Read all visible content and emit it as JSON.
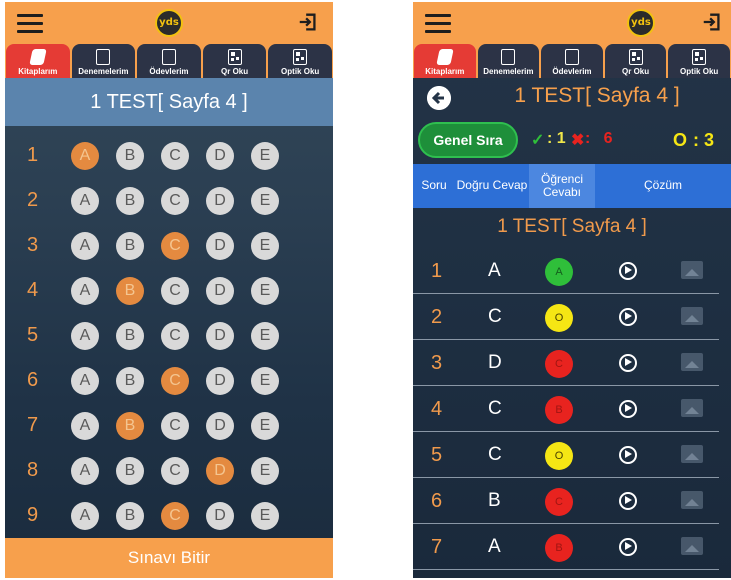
{
  "app": {
    "logo_text": "yds"
  },
  "tabs": [
    {
      "label": "Kitaplarım",
      "icon": "book-icon",
      "active": true
    },
    {
      "label": "Denemelerim",
      "icon": "exam-icon",
      "active": false
    },
    {
      "label": "Ödevlerim",
      "icon": "homework-icon",
      "active": false
    },
    {
      "label": "Qr Oku",
      "icon": "qr-icon",
      "active": false
    },
    {
      "label": "Optik Oku",
      "icon": "optic-icon",
      "active": false
    }
  ],
  "left": {
    "title": "1 TEST[ Sayfa 4 ]",
    "options": [
      "A",
      "B",
      "C",
      "D",
      "E"
    ],
    "questions": [
      {
        "num": "1",
        "selected": "A"
      },
      {
        "num": "2",
        "selected": ""
      },
      {
        "num": "3",
        "selected": "C"
      },
      {
        "num": "4",
        "selected": "B"
      },
      {
        "num": "5",
        "selected": ""
      },
      {
        "num": "6",
        "selected": "C"
      },
      {
        "num": "7",
        "selected": "B"
      },
      {
        "num": "8",
        "selected": "D"
      },
      {
        "num": "9",
        "selected": "C"
      }
    ],
    "finish_label": "Sınavı Bitir"
  },
  "right": {
    "title": "1 TEST[ Sayfa 4 ]",
    "genel_sira_label": "Genel Sıra",
    "stats": {
      "correct_icon": "✓",
      "correct_value": "1",
      "wrong_icon": "✖",
      "wrong_value": "6",
      "empty_label": "O",
      "empty_value": "3"
    },
    "columns": [
      "Soru",
      "Doğru Cevap",
      "Öğrenci Cevabı",
      "Çözüm"
    ],
    "subtitle": "1 TEST[ Sayfa 4 ]",
    "rows": [
      {
        "num": "1",
        "correct": "A",
        "student": "A",
        "status": "correct"
      },
      {
        "num": "2",
        "correct": "C",
        "student": "O",
        "status": "empty"
      },
      {
        "num": "3",
        "correct": "D",
        "student": "C",
        "status": "wrong"
      },
      {
        "num": "4",
        "correct": "C",
        "student": "B",
        "status": "wrong"
      },
      {
        "num": "5",
        "correct": "C",
        "student": "O",
        "status": "empty"
      },
      {
        "num": "6",
        "correct": "B",
        "student": "C",
        "status": "wrong"
      },
      {
        "num": "7",
        "correct": "A",
        "student": "B",
        "status": "wrong"
      }
    ],
    "status_colors": {
      "correct": "#2fbf3a",
      "empty": "#f5e614",
      "wrong": "#e8231f"
    }
  }
}
